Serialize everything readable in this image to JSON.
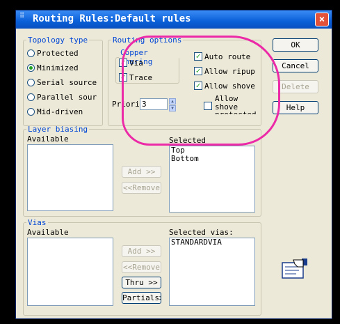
{
  "window": {
    "title": "Routing Rules:Default rules",
    "close_symbol": "×"
  },
  "topology": {
    "legend": "Topology type",
    "options": [
      {
        "label": "Protected",
        "selected": false
      },
      {
        "label": "Minimized",
        "selected": true
      },
      {
        "label": "Serial source",
        "selected": false
      },
      {
        "label": "Parallel sour",
        "selected": false
      },
      {
        "label": "Mid-driven",
        "selected": false
      }
    ]
  },
  "routing_options": {
    "legend": "Routing options",
    "copper_sharing": {
      "legend": "Copper sharing",
      "via": "Via",
      "trace": "Trace"
    },
    "priority_label": "Priori",
    "priority_value": "3",
    "auto_route": "Auto route",
    "allow_ripup": "Allow ripup",
    "allow_shove": "Allow shove",
    "allow_shove_protected_1": "Allow",
    "allow_shove_protected_2": "shove",
    "allow_shove_protected_3": "protected"
  },
  "buttons": {
    "ok": "OK",
    "cancel": "Cancel",
    "delete": "Delete",
    "help": "Help"
  },
  "layer_biasing": {
    "legend": "Layer biasing",
    "available_label": "Available",
    "selected_label": "Selected",
    "selected_items": [
      "Top",
      "Bottom"
    ],
    "add": "Add >>",
    "remove": "<<Remove"
  },
  "vias": {
    "legend": "Vias",
    "available_label": "Available",
    "selected_label": "Selected vias:",
    "selected_items": [
      "STANDARDVIA"
    ],
    "add": "Add >>",
    "remove": "<<Remove",
    "thru": "Thru >>",
    "partials": "Partials>>"
  },
  "check_mark": "✓",
  "spin_up": "▲",
  "spin_down": "▼",
  "title_icon_glyph": "⠿"
}
